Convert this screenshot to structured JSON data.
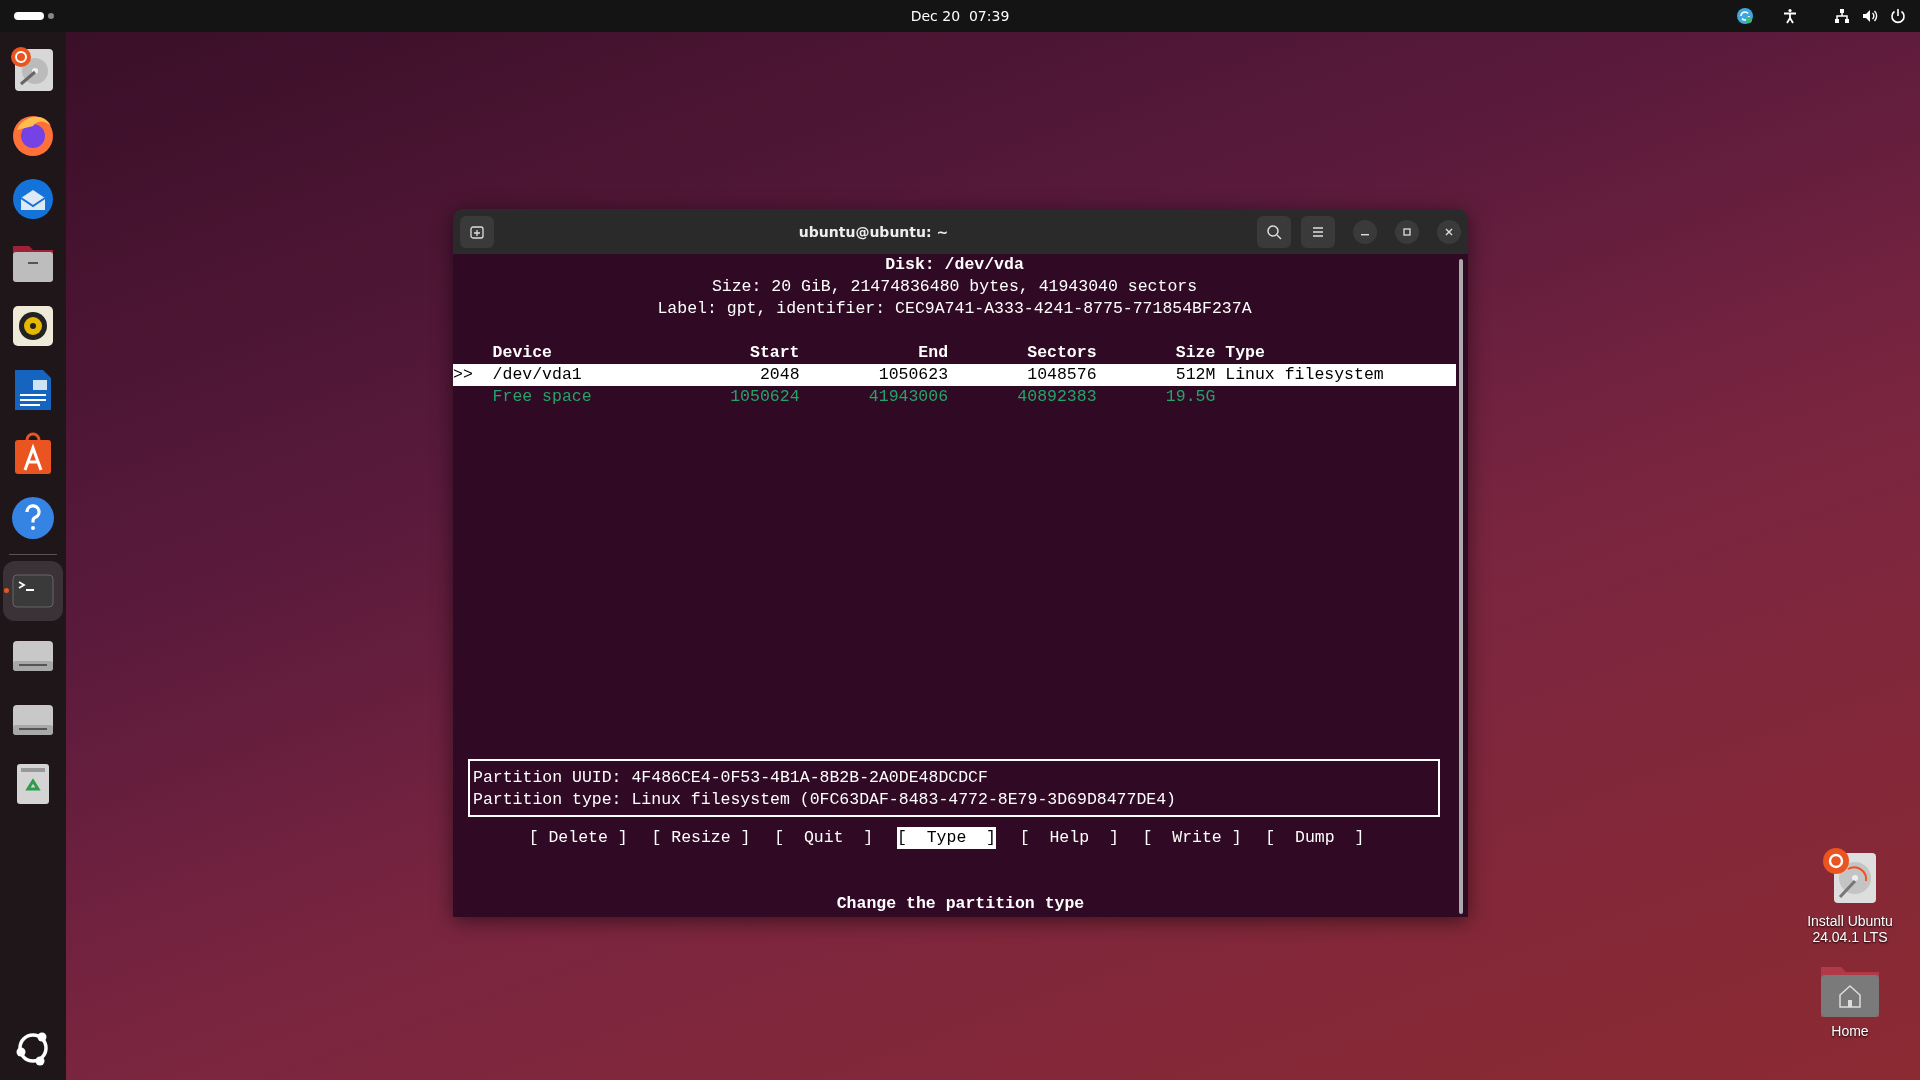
{
  "top_bar": {
    "clock": "Dec 20  07:39"
  },
  "dock": {
    "items": [
      {
        "kind": "installer",
        "running": false
      },
      {
        "kind": "firefox",
        "running": false
      },
      {
        "kind": "thunderbird",
        "running": false
      },
      {
        "kind": "files",
        "running": false
      },
      {
        "kind": "rhythmbox",
        "running": false
      },
      {
        "kind": "writer",
        "running": false
      },
      {
        "kind": "appcenter",
        "running": false
      },
      {
        "kind": "help",
        "running": false
      },
      {
        "kind": "terminal",
        "running": true
      },
      {
        "kind": "drive",
        "running": false
      },
      {
        "kind": "drive",
        "running": false
      },
      {
        "kind": "trash",
        "running": false
      }
    ]
  },
  "terminal": {
    "title": "ubuntu@ubuntu: ~",
    "disk_heading": "Disk: /dev/vda",
    "size_line": "Size: 20 GiB, 21474836480 bytes, 41943040 sectors",
    "label_line": "Label: gpt, identifier: CEC9A741-A333-4241-8775-771854BF237A",
    "columns": [
      "Device",
      "Start",
      "End",
      "Sectors",
      "Size",
      "Type"
    ],
    "rows": [
      {
        "kind": "partition",
        "selected": true,
        "pointer": ">>",
        "cells": [
          "/dev/vda1",
          "2048",
          "1050623",
          "1048576",
          "512M",
          "Linux filesystem"
        ]
      },
      {
        "kind": "free",
        "selected": false,
        "cells": [
          "Free space",
          "1050624",
          "41943006",
          "40892383",
          "19.5G"
        ]
      }
    ],
    "info": [
      "Partition UUID: 4F486CE4-0F53-4B1A-8B2B-2A0DE48DCDCF",
      "Partition type: Linux filesystem (0FC63DAF-8483-4772-8E79-3D69D8477DE4)"
    ],
    "buttons": [
      {
        "label": "[ Delete ]",
        "selected": false
      },
      {
        "label": "[ Resize ]",
        "selected": false
      },
      {
        "label": "[  Quit  ]",
        "selected": false
      },
      {
        "label": "[  Type  ]",
        "selected": true
      },
      {
        "label": "[  Help  ]",
        "selected": false
      },
      {
        "label": "[  Write ]",
        "selected": false
      },
      {
        "label": "[  Dump  ]",
        "selected": false
      }
    ],
    "hint": "Change the partition type"
  },
  "desktop_icons": [
    {
      "kind": "installer",
      "label": "Install Ubuntu 24.04.1 LTS"
    },
    {
      "kind": "home",
      "label": "Home"
    }
  ]
}
